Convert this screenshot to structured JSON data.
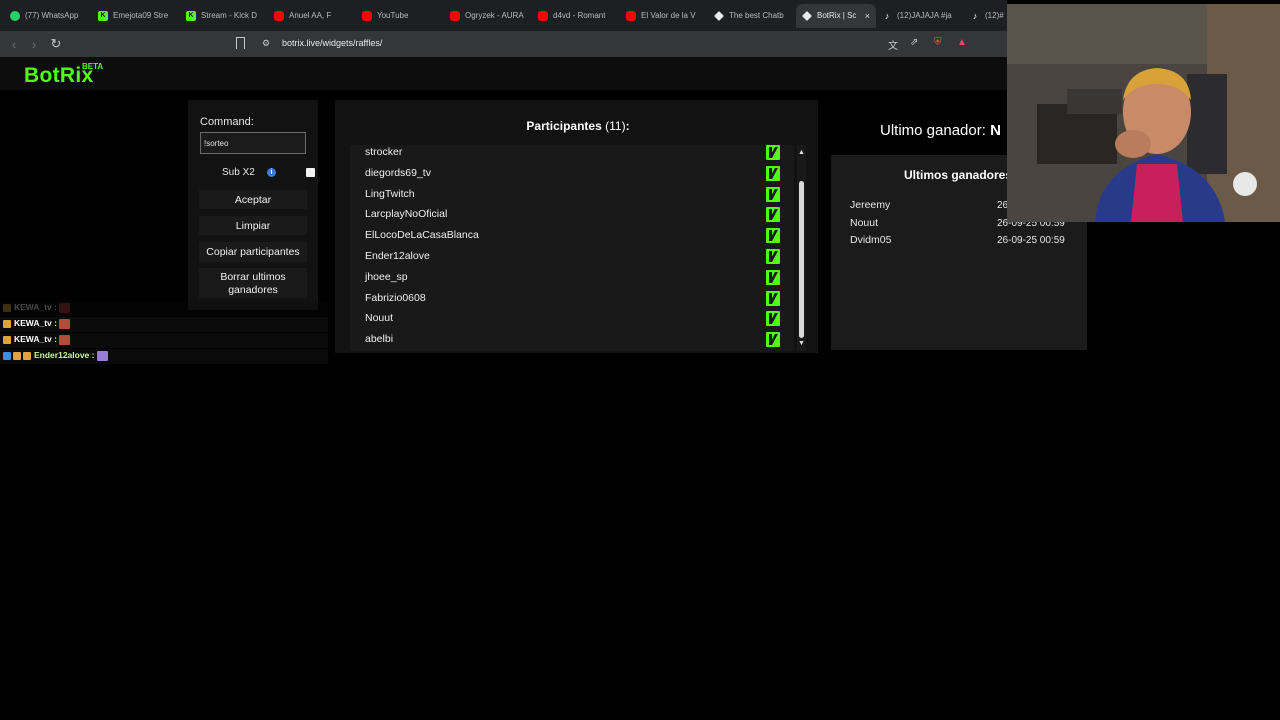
{
  "browser": {
    "tabs": [
      {
        "label": "(77) WhatsApp",
        "icon": "whatsapp-icon",
        "color": "#25d366"
      },
      {
        "label": "Emejota09 Stre",
        "icon": "kick-icon",
        "color": "#53fc18"
      },
      {
        "label": "Stream - Kick D",
        "icon": "kick-icon",
        "color": "#53fc18"
      },
      {
        "label": "Anuel AA, F",
        "icon": "youtube-icon",
        "color": "#ff0000"
      },
      {
        "label": "YouTube",
        "icon": "youtube-icon",
        "color": "#ff0000"
      },
      {
        "label": "Ogryzek - AURA",
        "icon": "youtube-icon",
        "color": "#ff0000"
      },
      {
        "label": "d4vd - Romant",
        "icon": "youtube-icon",
        "color": "#ff0000"
      },
      {
        "label": "El Valor de la V",
        "icon": "youtube-icon",
        "color": "#ff0000"
      },
      {
        "label": "The best Chatb",
        "icon": "botrix-icon",
        "color": "#e8eaed"
      },
      {
        "label": "BotRix | Sc",
        "icon": "botrix-icon",
        "color": "#e8eaed",
        "active": true
      },
      {
        "label": "(12)JAJAJA #ja",
        "icon": "tiktok-icon",
        "color": "#ffffff"
      },
      {
        "label": "(12)#",
        "icon": "tiktok-icon",
        "color": "#ffffff"
      }
    ],
    "url": "botrix.live/widgets/raffles/"
  },
  "app": {
    "logo": "BotRix",
    "beta": "BETA",
    "accent": "#53fc18"
  },
  "controls": {
    "command_label": "Command:",
    "command_value": "!sorteo",
    "sub_label": "Sub X2",
    "accept": "Aceptar",
    "clear": "Limpiar",
    "copy": "Copiar participantes",
    "delete_1": "Borrar ultimos",
    "delete_2": "ganadores"
  },
  "participants": {
    "title": "Participantes",
    "count": "(11)",
    "colon": ":",
    "names": [
      "strocker",
      "diegords69_tv",
      "LingTwitch",
      "LarcplayNoOficial",
      "ElLocoDeLaCasaBlanca",
      "Ender12alove",
      "jhoee_sp",
      "Fabrizio0608",
      "Nouut",
      "abelbi"
    ]
  },
  "last_winner": {
    "label": "Ultimo ganador:",
    "value": "N"
  },
  "recent_winners": {
    "title": "Ultimos ganadores",
    "items": [
      {
        "name": "Jereemy",
        "date": "26"
      },
      {
        "name": "Nouut",
        "date": "26-09-25 00:59"
      },
      {
        "name": "Dvidm05",
        "date": "26-09-25 00:59"
      }
    ]
  },
  "chat": [
    {
      "user": "KEWA_tv :",
      "color": "#ffffff",
      "faded": true
    },
    {
      "user": "KEWA_tv :",
      "color": "#ffffff"
    },
    {
      "user": "KEWA_tv :",
      "color": "#ffffff"
    },
    {
      "user": "Ender12alove :",
      "color": "#c8f5a5"
    }
  ]
}
